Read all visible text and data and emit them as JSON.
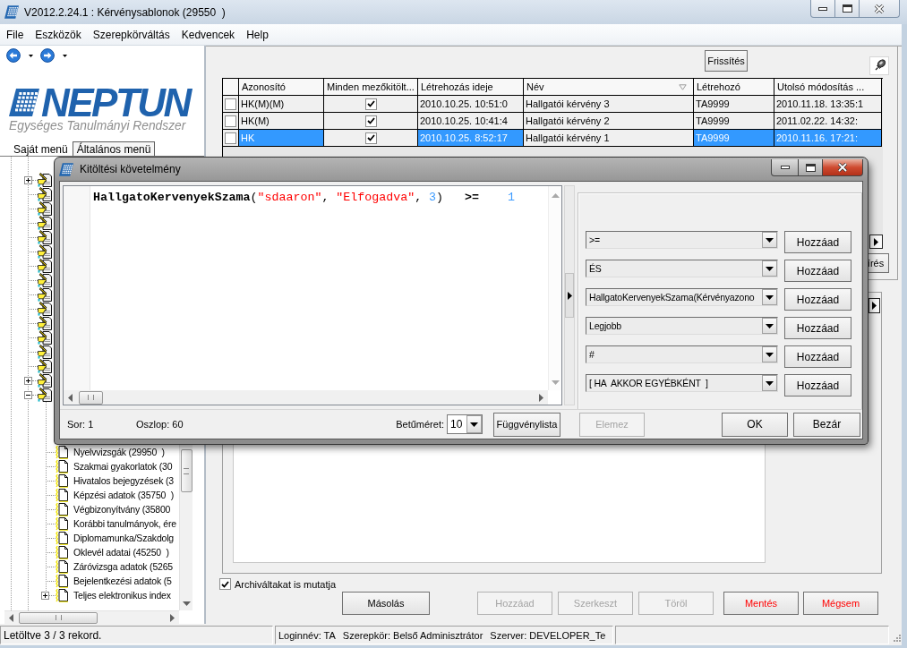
{
  "window": {
    "title": "V2012.2.24.1 : Kérvénysablonok (29550  )"
  },
  "menu": [
    {
      "label": "File"
    },
    {
      "label": "Eszközök"
    },
    {
      "label": "Szerepkörváltás"
    },
    {
      "label": "Kedvencek"
    },
    {
      "label": "Help"
    }
  ],
  "sidebar": {
    "logo": {
      "wordmark": "NEPTUN",
      "tagline": "Egységes Tanulmányi Rendszer"
    },
    "tabs": [
      {
        "label": "Saját menü",
        "selected": false
      },
      {
        "label": "Általános menü",
        "selected": true
      }
    ],
    "tree": [
      {
        "kind": "branch",
        "expanded": false
      },
      {
        "kind": "leaf"
      },
      {
        "kind": "leaf"
      },
      {
        "kind": "leaf"
      },
      {
        "kind": "leaf"
      },
      {
        "kind": "leaf"
      },
      {
        "kind": "leaf"
      },
      {
        "kind": "leaf"
      },
      {
        "kind": "leaf"
      },
      {
        "kind": "leaf"
      },
      {
        "kind": "leaf"
      },
      {
        "kind": "leaf"
      },
      {
        "kind": "leaf"
      },
      {
        "kind": "leaf"
      },
      {
        "kind": "branch",
        "expanded": false
      },
      {
        "kind": "branch",
        "expanded": true,
        "children": [
          {
            "kind": "leaf",
            "label": "Nyelvvizsgák (29950  )"
          },
          {
            "kind": "leaf",
            "label": "Szakmai gyakorlatok (30"
          },
          {
            "kind": "leaf",
            "label": "Hivatalos bejegyzések (3"
          },
          {
            "kind": "leaf",
            "label": "Képzési adatok (35750  )"
          },
          {
            "kind": "leaf",
            "label": "Végbizonyítvány (35800"
          },
          {
            "kind": "leaf",
            "label": "Korábbi tanulmányok, ére"
          },
          {
            "kind": "leaf",
            "label": "Diplomamunka/Szakdolg"
          },
          {
            "kind": "leaf",
            "label": "Oklevél adatai (45250  )"
          },
          {
            "kind": "leaf",
            "label": "Záróvizsga adatok (5265"
          },
          {
            "kind": "leaf",
            "label": "Bejelentkezési adatok (5"
          },
          {
            "kind": "branch",
            "expanded": false,
            "label": "Teljes elektronikus index"
          }
        ]
      }
    ]
  },
  "toolbar": {
    "refresh": "Frissítés"
  },
  "table": {
    "columns": [
      {
        "label": "Azonosító",
        "kind": "text",
        "sorted": false
      },
      {
        "label": "Minden mezőkitölt...",
        "kind": "check",
        "sorted": false
      },
      {
        "label": "Létrehozás ideje",
        "kind": "text",
        "sorted": false
      },
      {
        "label": "Név",
        "kind": "edit",
        "sorted": true
      },
      {
        "label": "Létrehozó",
        "kind": "text",
        "sorted": false
      },
      {
        "label": "Utolsó módosítás ...",
        "kind": "text",
        "sorted": false
      }
    ],
    "rows": [
      {
        "checked": false,
        "selected": false,
        "cells": [
          "HK(M)(M)",
          true,
          "2010.10.25. 10:51:0",
          "Hallgatói kérvény 3",
          "TA9999",
          "2010.11.18. 13:35:1"
        ]
      },
      {
        "checked": false,
        "selected": false,
        "cells": [
          "HK(M)",
          true,
          "2010.10.25. 10:41:4",
          "Hallgatói kérvény 2",
          "TA9999",
          "2011.02.22. 14:32:"
        ]
      },
      {
        "checked": false,
        "selected": true,
        "cells": [
          "HK",
          true,
          "2010.10.25. 8:52:17",
          "Hallgatói kérvény 1",
          "TA9999",
          "2010.11.16. 17:21:"
        ]
      }
    ]
  },
  "side_button": {
    "label": "írés"
  },
  "archived": {
    "label": "Archiváltakat is mutatja",
    "checked": true
  },
  "actions": {
    "copy": {
      "label": "Másolás",
      "disabled": false
    },
    "edit": [
      {
        "label": "Hozzáad",
        "disabled": true
      },
      {
        "label": "Szerkeszt",
        "disabled": true
      },
      {
        "label": "Töröl",
        "disabled": true
      }
    ],
    "commit": [
      {
        "label": "Mentés",
        "disabled": false
      },
      {
        "label": "Mégsem",
        "disabled": false
      }
    ]
  },
  "status_bar": {
    "message": "Letöltve 3 / 3 rekord.",
    "session": [
      "Loginnév: TA",
      "Szerepkör: Belső Adminisztrátor",
      "Szerver: DEVELOPER_Te"
    ]
  },
  "dialog": {
    "title": "Kitöltési követelmény",
    "editor": {
      "lines": [
        [
          {
            "kind": "function",
            "text": "HallgatoKervenyekSzama"
          },
          {
            "kind": "punct",
            "text": "("
          },
          {
            "kind": "string",
            "text": "\"sdaaron\""
          },
          {
            "kind": "punct",
            "text": ", "
          },
          {
            "kind": "string",
            "text": "\"Elfogadva\""
          },
          {
            "kind": "punct",
            "text": ", "
          },
          {
            "kind": "number",
            "text": "3"
          },
          {
            "kind": "punct",
            "text": ")"
          },
          {
            "kind": "operator",
            "text": "   >=    "
          },
          {
            "kind": "number",
            "text": "1"
          }
        ]
      ]
    },
    "inserts": [
      {
        "value": ">=",
        "button": "Hozzáad"
      },
      {
        "value": "ÉS",
        "button": "Hozzáad"
      },
      {
        "value": "HallgatoKervenyekSzama(Kérvényazono",
        "button": "Hozzáad"
      },
      {
        "value": "Legjobb",
        "button": "Hozzáad"
      },
      {
        "value": "#",
        "button": "Hozzáad"
      },
      {
        "value": "[ HA  AKKOR EGYÉBKÉNT  ]",
        "button": "Hozzáad"
      }
    ],
    "position": {
      "row": "Sor: 1",
      "column": "Oszlop: 60"
    },
    "font_size": {
      "label": "Betűméret:",
      "value": "10"
    },
    "tools": [
      {
        "label": "Függvénylista",
        "disabled": false
      },
      {
        "label": "Elemez",
        "disabled": true
      }
    ],
    "buttons": [
      {
        "label": "OK",
        "disabled": false
      },
      {
        "label": "Bezár",
        "disabled": false
      }
    ]
  }
}
